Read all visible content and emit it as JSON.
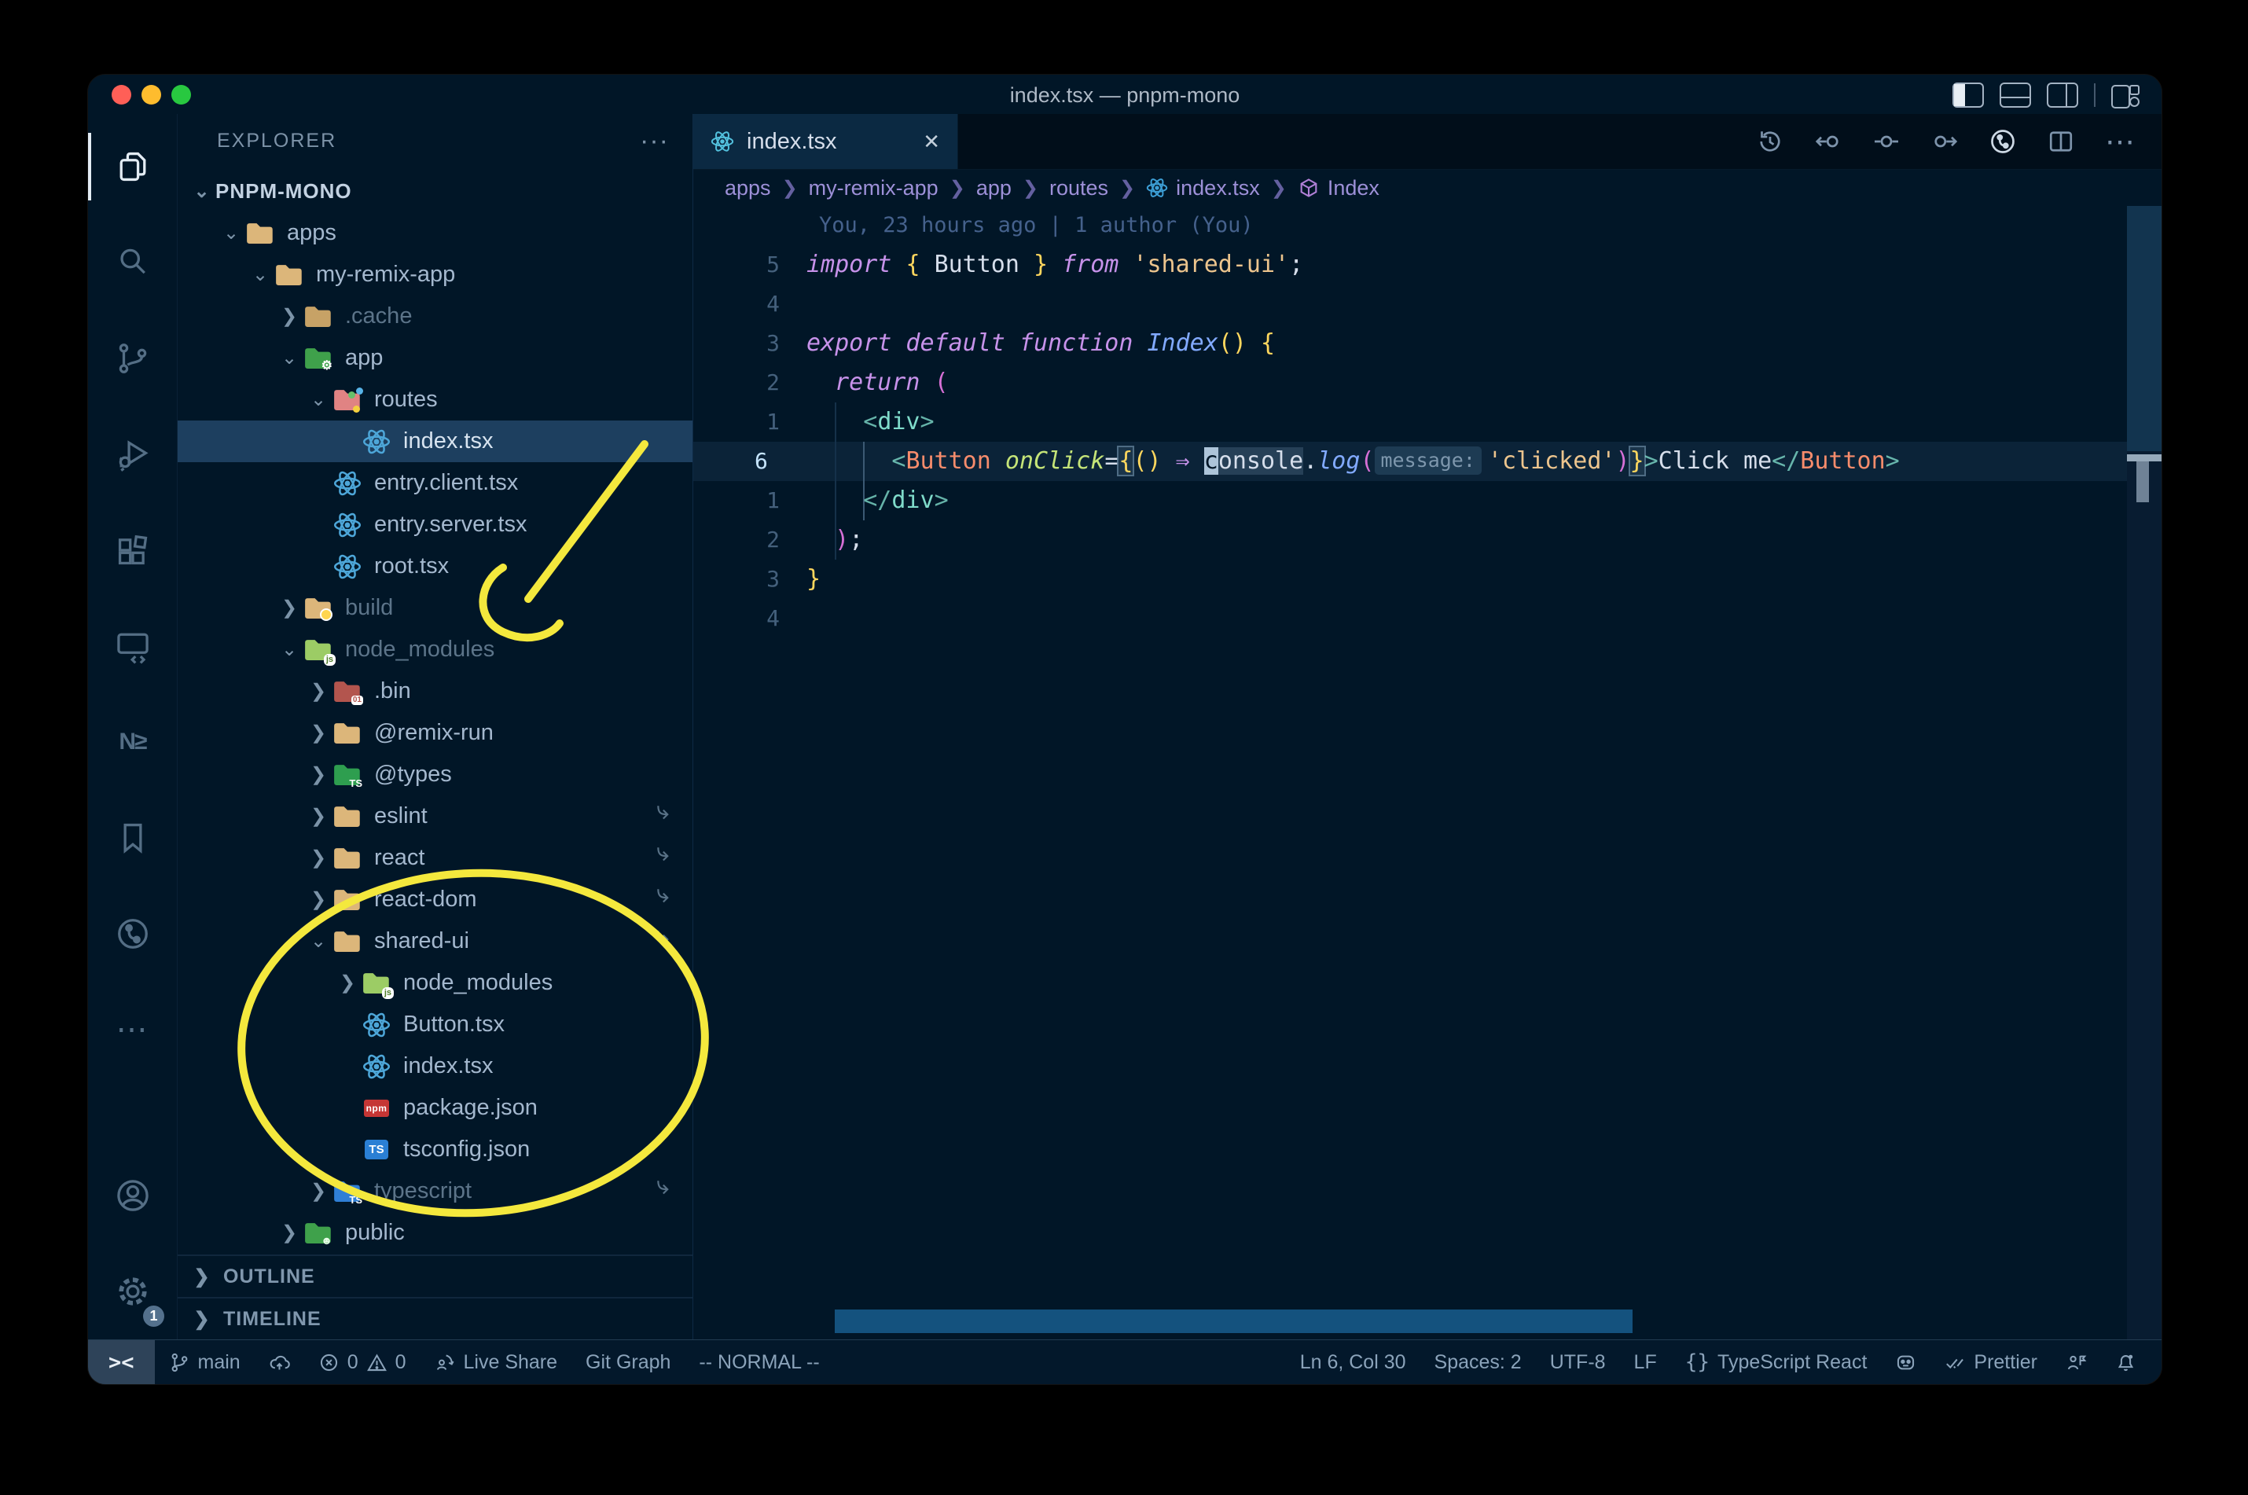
{
  "window": {
    "title": "index.tsx — pnpm-mono"
  },
  "traffic_lights": {
    "close": "#ff5f57",
    "minimize": "#febc2e",
    "zoom": "#28c840"
  },
  "activity_bar": {
    "items": [
      {
        "name": "explorer",
        "active": true
      },
      {
        "name": "search",
        "active": false
      },
      {
        "name": "source-control",
        "active": false
      },
      {
        "name": "run-debug",
        "active": false
      },
      {
        "name": "extensions",
        "active": false
      },
      {
        "name": "remote-explorer",
        "active": false
      },
      {
        "name": "nx-console",
        "active": false,
        "text": "N≥"
      },
      {
        "name": "bookmarks",
        "active": false
      },
      {
        "name": "git-graph",
        "active": false
      },
      {
        "name": "more-views",
        "active": false,
        "text": "⋯"
      }
    ],
    "account": "account",
    "settings": "settings",
    "settings_badge": "1"
  },
  "explorer": {
    "header": "EXPLORER",
    "header_more": "···",
    "tree": [
      {
        "label": "PNPM-MONO",
        "level": 0,
        "chevron": "down",
        "root": true
      },
      {
        "label": "apps",
        "level": 1,
        "chevron": "down",
        "icon": {
          "type": "folder",
          "fill": "#dcb67a"
        }
      },
      {
        "label": "my-remix-app",
        "level": 2,
        "chevron": "down",
        "icon": {
          "type": "folder",
          "fill": "#dcb67a"
        }
      },
      {
        "label": ".cache",
        "level": 3,
        "chevron": "right",
        "dim": true,
        "icon": {
          "type": "folder",
          "fill": "#c7a266"
        }
      },
      {
        "label": "app",
        "level": 3,
        "chevron": "down",
        "icon": {
          "type": "folder",
          "fill": "#3fa14b",
          "badge": "gear"
        }
      },
      {
        "label": "routes",
        "level": 4,
        "chevron": "down",
        "icon": {
          "type": "folder",
          "fill": "#e08383",
          "badge": "dots"
        }
      },
      {
        "label": "index.tsx",
        "level": 5,
        "selected": true,
        "icon": {
          "type": "react"
        }
      },
      {
        "label": "entry.client.tsx",
        "level": 4,
        "icon": {
          "type": "react"
        }
      },
      {
        "label": "entry.server.tsx",
        "level": 4,
        "icon": {
          "type": "react"
        }
      },
      {
        "label": "root.tsx",
        "level": 4,
        "icon": {
          "type": "react"
        }
      },
      {
        "label": "build",
        "level": 3,
        "chevron": "right",
        "dim": true,
        "icon": {
          "type": "folder",
          "fill": "#dcb67a",
          "badge": "dot"
        }
      },
      {
        "label": "node_modules",
        "level": 3,
        "chevron": "down",
        "dim": true,
        "icon": {
          "type": "folder",
          "fill": "#9ccc65",
          "badge": "js"
        }
      },
      {
        "label": ".bin",
        "level": 4,
        "chevron": "right",
        "icon": {
          "type": "folder",
          "fill": "#b3554e",
          "badge": "bin"
        }
      },
      {
        "label": "@remix-run",
        "level": 4,
        "chevron": "right",
        "icon": {
          "type": "folder",
          "fill": "#dcb67a"
        }
      },
      {
        "label": "@types",
        "level": 4,
        "chevron": "right",
        "icon": {
          "type": "folder",
          "fill": "#2e9e4f",
          "badge": "TS"
        }
      },
      {
        "label": "eslint",
        "level": 4,
        "chevron": "right",
        "symlink": true,
        "icon": {
          "type": "folder",
          "fill": "#dcb67a"
        }
      },
      {
        "label": "react",
        "level": 4,
        "chevron": "right",
        "symlink": true,
        "icon": {
          "type": "folder",
          "fill": "#dcb67a"
        }
      },
      {
        "label": "react-dom",
        "level": 4,
        "chevron": "right",
        "symlink": true,
        "icon": {
          "type": "folder",
          "fill": "#dcb67a"
        }
      },
      {
        "label": "shared-ui",
        "level": 4,
        "chevron": "down",
        "symlink": true,
        "icon": {
          "type": "folder",
          "fill": "#dcb67a"
        }
      },
      {
        "label": "node_modules",
        "level": 5,
        "chevron": "right",
        "icon": {
          "type": "folder",
          "fill": "#9ccc65",
          "badge": "js"
        }
      },
      {
        "label": "Button.tsx",
        "level": 5,
        "icon": {
          "type": "react"
        }
      },
      {
        "label": "index.tsx",
        "level": 5,
        "icon": {
          "type": "react"
        }
      },
      {
        "label": "package.json",
        "level": 5,
        "icon": {
          "type": "npm"
        }
      },
      {
        "label": "tsconfig.json",
        "level": 5,
        "icon": {
          "type": "tsfile"
        }
      },
      {
        "label": "typescript",
        "level": 4,
        "chevron": "right",
        "dim": true,
        "symlink": true,
        "icon": {
          "type": "folder",
          "fill": "#2f7fd6",
          "badge": "TS"
        }
      },
      {
        "label": "public",
        "level": 3,
        "chevron": "right",
        "icon": {
          "type": "folder",
          "fill": "#3fa14b",
          "badge": "people"
        }
      }
    ],
    "sections": [
      "OUTLINE",
      "TIMELINE"
    ]
  },
  "editor": {
    "tab": {
      "label": "index.tsx",
      "close": "✕"
    },
    "breadcrumbs": [
      {
        "label": "apps"
      },
      {
        "label": "my-remix-app"
      },
      {
        "label": "app"
      },
      {
        "label": "routes"
      },
      {
        "label": "index.tsx",
        "icon": "react"
      },
      {
        "label": "Index",
        "icon": "symbol"
      }
    ],
    "blame": "You, 23 hours ago | 1 author (You)",
    "code": {
      "lines": [
        {
          "num": "5",
          "tokens": [
            {
              "t": "import ",
              "c": "kw"
            },
            {
              "t": "{ ",
              "c": "b1"
            },
            {
              "t": "Button",
              "c": "pl"
            },
            {
              "t": " }",
              "c": "b1"
            },
            {
              "t": " from ",
              "c": "kw"
            },
            {
              "t": "'shared-ui'",
              "c": "str"
            },
            {
              "t": ";",
              "c": "pl"
            }
          ]
        },
        {
          "num": "4",
          "tokens": []
        },
        {
          "num": "3",
          "tokens": [
            {
              "t": "export default function ",
              "c": "kw"
            },
            {
              "t": "Index",
              "c": "fn"
            },
            {
              "t": "()",
              "c": "b1"
            },
            {
              "t": " ",
              "c": "pl"
            },
            {
              "t": "{",
              "c": "b1"
            }
          ]
        },
        {
          "num": "2",
          "tokens": [
            {
              "t": "  ",
              "c": "pl"
            },
            {
              "t": "return ",
              "c": "kw"
            },
            {
              "t": "(",
              "c": "b2"
            }
          ]
        },
        {
          "num": "1",
          "tokens": [
            {
              "t": "    ",
              "c": "pl"
            },
            {
              "t": "<",
              "c": "tp"
            },
            {
              "t": "div",
              "c": "tag"
            },
            {
              "t": ">",
              "c": "tp"
            }
          ]
        },
        {
          "num": "6",
          "current": true,
          "tokens": [
            {
              "t": "      ",
              "c": "pl"
            },
            {
              "t": "<",
              "c": "tp"
            },
            {
              "t": "Button",
              "c": "cmp"
            },
            {
              "t": " ",
              "c": "pl"
            },
            {
              "t": "onClick",
              "c": "attr"
            },
            {
              "t": "=",
              "c": "pl"
            },
            {
              "t": "{",
              "c": "b1 box"
            },
            {
              "t": "()",
              "c": "b1"
            },
            {
              "t": " ",
              "c": "pl"
            },
            {
              "t": "⇒",
              "c": "arw"
            },
            {
              "t": " ",
              "c": "pl"
            },
            {
              "t": "c",
              "c": "pl cursor"
            },
            {
              "t": "onsole",
              "c": "pl whl"
            },
            {
              "t": ".",
              "c": "pl"
            },
            {
              "t": "log",
              "c": "fn"
            },
            {
              "t": "(",
              "c": "b2"
            },
            {
              "t": "message:",
              "c": "inlay"
            },
            {
              "t": "'clicked'",
              "c": "str"
            },
            {
              "t": ")",
              "c": "b2"
            },
            {
              "t": "}",
              "c": "b1 box"
            },
            {
              "t": ">",
              "c": "tp"
            },
            {
              "t": "Click me",
              "c": "pl"
            },
            {
              "t": "</",
              "c": "tp"
            },
            {
              "t": "Button",
              "c": "cmp"
            },
            {
              "t": ">",
              "c": "tp"
            }
          ]
        },
        {
          "num": "1",
          "tokens": [
            {
              "t": "    ",
              "c": "pl"
            },
            {
              "t": "</",
              "c": "tp"
            },
            {
              "t": "div",
              "c": "tag"
            },
            {
              "t": ">",
              "c": "tp"
            }
          ]
        },
        {
          "num": "2",
          "tokens": [
            {
              "t": "  ",
              "c": "pl"
            },
            {
              "t": ")",
              "c": "b2"
            },
            {
              "t": ";",
              "c": "pl"
            }
          ]
        },
        {
          "num": "3",
          "tokens": [
            {
              "t": "}",
              "c": "b1"
            }
          ]
        },
        {
          "num": "4",
          "tokens": []
        }
      ]
    }
  },
  "status_bar": {
    "branch": "main",
    "errors": "0",
    "warnings": "0",
    "live_share": "Live Share",
    "git_graph": "Git Graph",
    "vim_mode": "-- NORMAL --",
    "cursor_pos": "Ln 6, Col 30",
    "indentation": "Spaces: 2",
    "encoding": "UTF-8",
    "eol": "LF",
    "language_brackets": "{}",
    "language": "TypeScript React",
    "formatter": "Prettier"
  },
  "annotations": {
    "color": "#f4e83d"
  },
  "colors": {
    "editor_bg": "#011627",
    "active_tab_bg": "#0b2942",
    "selection_bg": "#1d3f5f",
    "scrollbar_blue": "#14527e",
    "keyword": "#c792ea",
    "string": "#ecc48d",
    "component": "#f78c6c",
    "jsx_tag": "#7fdbca"
  }
}
